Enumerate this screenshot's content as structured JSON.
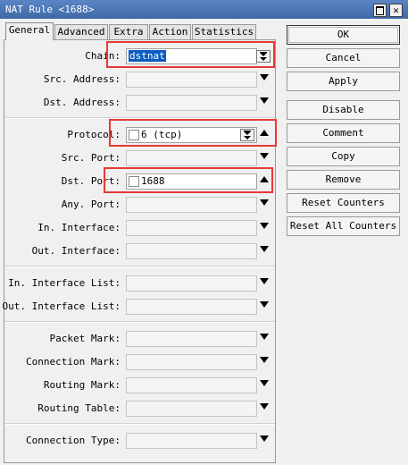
{
  "window": {
    "title": "NAT Rule <1688>"
  },
  "tabs": [
    {
      "label": "General"
    },
    {
      "label": "Advanced"
    },
    {
      "label": "Extra"
    },
    {
      "label": "Action"
    },
    {
      "label": "Statistics"
    }
  ],
  "form": {
    "chain": {
      "label": "Chain:",
      "value": "dstnat"
    },
    "src_address": {
      "label": "Src. Address:"
    },
    "dst_address": {
      "label": "Dst. Address:"
    },
    "protocol": {
      "label": "Protocol:",
      "value": "6 (tcp)"
    },
    "src_port": {
      "label": "Src. Port:"
    },
    "dst_port": {
      "label": "Dst. Port:",
      "value": "1688"
    },
    "any_port": {
      "label": "Any. Port:"
    },
    "in_interface": {
      "label": "In. Interface:"
    },
    "out_interface": {
      "label": "Out. Interface:"
    },
    "in_interface_list": {
      "label": "In. Interface List:"
    },
    "out_interface_list": {
      "label": "Out. Interface List:"
    },
    "packet_mark": {
      "label": "Packet Mark:"
    },
    "connection_mark": {
      "label": "Connection Mark:"
    },
    "routing_mark": {
      "label": "Routing Mark:"
    },
    "routing_table": {
      "label": "Routing Table:"
    },
    "connection_type": {
      "label": "Connection Type:"
    }
  },
  "buttons": {
    "ok": "OK",
    "cancel": "Cancel",
    "apply": "Apply",
    "disable": "Disable",
    "comment": "Comment",
    "copy": "Copy",
    "remove": "Remove",
    "reset_counters": "Reset Counters",
    "reset_all_counters": "Reset All Counters"
  },
  "colors": {
    "highlight_box": "#e53935",
    "titlebar": "#4a6fa5",
    "selection": "#0a5bc0"
  }
}
